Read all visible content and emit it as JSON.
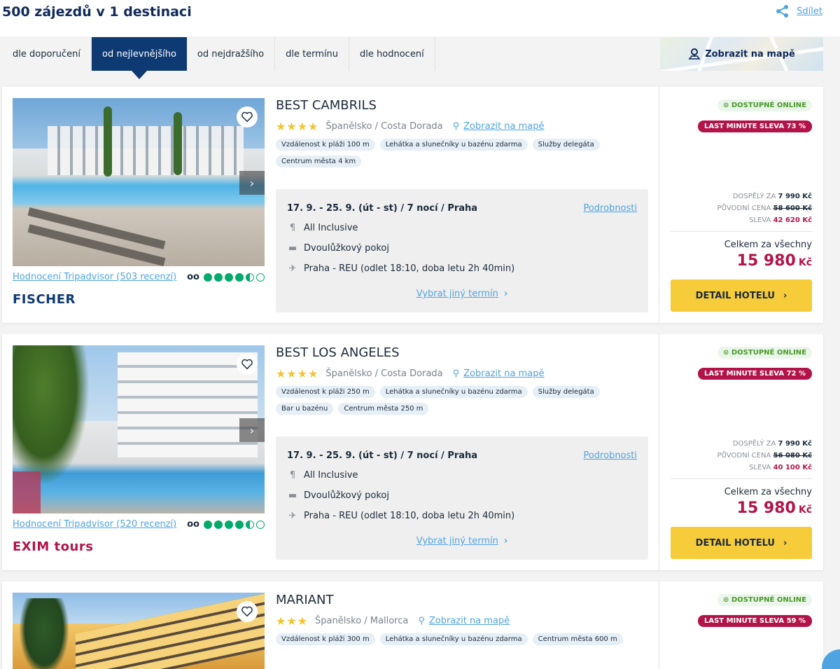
{
  "header": {
    "title": "500 zájezdů v 1 destinaci",
    "share_label": "Sdílet"
  },
  "sort": {
    "tabs": [
      {
        "label": "dle doporučení",
        "active": false
      },
      {
        "label": "od nejlevnějšího",
        "active": true
      },
      {
        "label": "od nejdražšího",
        "active": false
      },
      {
        "label": "dle termínu",
        "active": false
      },
      {
        "label": "dle hodnocení",
        "active": false
      }
    ],
    "map_label": "Zobrazit na mapě"
  },
  "hotels": [
    {
      "name": "BEST CAMBRILS",
      "stars": 4,
      "stars_text": "★★★★",
      "location": "Španělsko / Costa Dorada",
      "map_link": "Zobrazit na mapě",
      "tags": [
        "Vzdálenost k pláži 100 m",
        "Lehátka a slunečníky u bazénu zdarma",
        "Služby delegáta",
        "Centrum města 4 km"
      ],
      "tripadvisor": "Hodnocení Tripadvisor (503 recenzí)",
      "tripadvisor_rating": 4.5,
      "operator": "FISCHER",
      "term": "17. 9. - 25. 9. (út - st) / 7 nocí / Praha",
      "details_label": "Podrobnosti",
      "board": "All Inclusive",
      "room": "Dvoulůžkový pokoj",
      "flight": "Praha - REU (odlet 18:10, doba letu 2h 40min)",
      "other_term": "Vybrat jiný termín",
      "online": "DOSTUPNÉ ONLINE",
      "sale": "LAST MINUTE SLEVA 73 %",
      "adult_label": "DOSPĚLÝ ZA",
      "adult_price": "7 990 Kč",
      "orig_label": "PŮVODNÍ CENA",
      "orig_price": "58 600 Kč",
      "discount_label": "SLEVA",
      "discount": "42 620 Kč",
      "total_label": "Celkem za všechny",
      "total": "15 980",
      "currency": "Kč",
      "detail_button": "DETAIL HOTELU"
    },
    {
      "name": "BEST LOS ANGELES",
      "stars": 4,
      "stars_text": "★★★★",
      "location": "Španělsko / Costa Dorada",
      "map_link": "Zobrazit na mapě",
      "tags": [
        "Vzdálenost k pláži 250 m",
        "Lehátka a slunečníky u bazénu zdarma",
        "Služby delegáta",
        "Bar u bazénu",
        "Centrum města 250 m"
      ],
      "tripadvisor": "Hodnocení Tripadvisor (520 recenzí)",
      "tripadvisor_rating": 4.5,
      "operator": "EXIM tours",
      "term": "17. 9. - 25. 9. (út - st) / 7 nocí / Praha",
      "details_label": "Podrobnosti",
      "board": "All Inclusive",
      "room": "Dvoulůžkový pokoj",
      "flight": "Praha - REU (odlet 18:10, doba letu 2h 40min)",
      "other_term": "Vybrat jiný termín",
      "online": "DOSTUPNÉ ONLINE",
      "sale": "LAST MINUTE SLEVA 72 %",
      "adult_label": "DOSPĚLÝ ZA",
      "adult_price": "7 990 Kč",
      "orig_label": "PŮVODNÍ CENA",
      "orig_price": "56 080 Kč",
      "discount_label": "SLEVA",
      "discount": "40 100 Kč",
      "total_label": "Celkem za všechny",
      "total": "15 980",
      "currency": "Kč",
      "detail_button": "DETAIL HOTELU"
    },
    {
      "name": "MARIANT",
      "stars": 3,
      "stars_text": "★★★",
      "location": "Španělsko / Mallorca",
      "map_link": "Zobrazit na mapě",
      "tags": [
        "Vzdálenost k pláži 300 m",
        "Lehátka a slunečníky u bazénu zdarma",
        "Centrum města 600 m"
      ],
      "online": "DOSTUPNÉ ONLINE",
      "sale": "LAST MINUTE SLEVA 59 %"
    }
  ],
  "colors": {
    "navy": "#0e3a74",
    "accent_red": "#b2144a",
    "button_yellow": "#f6cc3a",
    "link_blue": "#4fa3e0"
  }
}
